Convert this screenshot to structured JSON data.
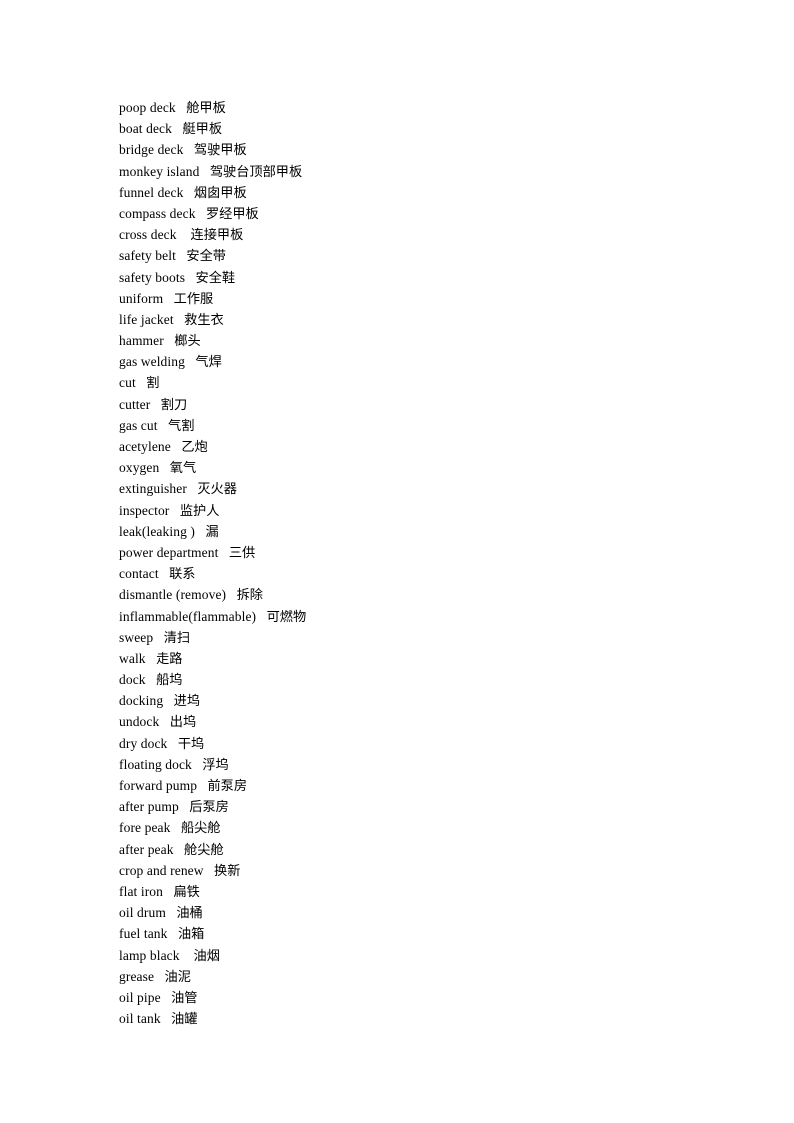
{
  "document": {
    "page_background": "#ffffff",
    "text_color": "#000000",
    "entries": [
      {
        "term": "poop deck",
        "gap": "   ",
        "gloss": "舱甲板"
      },
      {
        "term": "boat deck",
        "gap": "   ",
        "gloss": "艇甲板"
      },
      {
        "term": "bridge deck",
        "gap": "   ",
        "gloss": "驾驶甲板"
      },
      {
        "term": "monkey island",
        "gap": "   ",
        "gloss": "驾驶台顶部甲板"
      },
      {
        "term": "funnel deck",
        "gap": "   ",
        "gloss": "烟囱甲板"
      },
      {
        "term": "compass deck",
        "gap": "   ",
        "gloss": "罗经甲板"
      },
      {
        "term": "cross deck",
        "gap": "    ",
        "gloss": "连接甲板"
      },
      {
        "term": "safety belt",
        "gap": "   ",
        "gloss": "安全带"
      },
      {
        "term": "safety boots",
        "gap": "   ",
        "gloss": "安全鞋"
      },
      {
        "term": "uniform",
        "gap": "   ",
        "gloss": "工作服"
      },
      {
        "term": "life jacket",
        "gap": "   ",
        "gloss": "救生衣"
      },
      {
        "term": "hammer",
        "gap": "   ",
        "gloss": "榔头"
      },
      {
        "term": "gas welding",
        "gap": "   ",
        "gloss": "气焊"
      },
      {
        "term": "cut",
        "gap": "   ",
        "gloss": "割"
      },
      {
        "term": "cutter",
        "gap": "   ",
        "gloss": "割刀"
      },
      {
        "term": "gas cut",
        "gap": "   ",
        "gloss": "气割"
      },
      {
        "term": "acetylene",
        "gap": "   ",
        "gloss": "乙炮"
      },
      {
        "term": "oxygen",
        "gap": "   ",
        "gloss": "氧气"
      },
      {
        "term": "extinguisher",
        "gap": "   ",
        "gloss": "灭火器"
      },
      {
        "term": "inspector",
        "gap": "   ",
        "gloss": "监护人"
      },
      {
        "term": "leak(leaking )",
        "gap": "   ",
        "gloss": "漏"
      },
      {
        "term": "power department",
        "gap": "   ",
        "gloss": "三供"
      },
      {
        "term": "contact",
        "gap": "   ",
        "gloss": "联系"
      },
      {
        "term": "dismantle (remove)",
        "gap": "   ",
        "gloss": "拆除"
      },
      {
        "term": "inflammable(flammable)",
        "gap": "   ",
        "gloss": "可燃物"
      },
      {
        "term": "sweep",
        "gap": "   ",
        "gloss": "清扫"
      },
      {
        "term": "walk",
        "gap": "   ",
        "gloss": "走路"
      },
      {
        "term": "dock",
        "gap": "   ",
        "gloss": "船坞"
      },
      {
        "term": "docking",
        "gap": "   ",
        "gloss": "进坞"
      },
      {
        "term": "undock",
        "gap": "   ",
        "gloss": "出坞"
      },
      {
        "term": "dry dock",
        "gap": "   ",
        "gloss": "干坞"
      },
      {
        "term": "floating dock",
        "gap": "   ",
        "gloss": "浮坞"
      },
      {
        "term": "forward pump",
        "gap": "   ",
        "gloss": "前泵房"
      },
      {
        "term": "after pump",
        "gap": "   ",
        "gloss": "后泵房"
      },
      {
        "term": "fore peak",
        "gap": "   ",
        "gloss": "船尖舱"
      },
      {
        "term": "after peak",
        "gap": "   ",
        "gloss": "舱尖舱"
      },
      {
        "term": "crop and renew",
        "gap": "   ",
        "gloss": "换新"
      },
      {
        "term": "flat iron",
        "gap": "   ",
        "gloss": "扁铁"
      },
      {
        "term": "oil drum",
        "gap": "   ",
        "gloss": "油桶"
      },
      {
        "term": "fuel tank",
        "gap": "   ",
        "gloss": "油箱"
      },
      {
        "term": "lamp black",
        "gap": "    ",
        "gloss": "油烟"
      },
      {
        "term": "grease",
        "gap": "   ",
        "gloss": "油泥"
      },
      {
        "term": "oil pipe",
        "gap": "   ",
        "gloss": "油管"
      },
      {
        "term": "oil tank",
        "gap": "   ",
        "gloss": "油罐"
      }
    ]
  }
}
